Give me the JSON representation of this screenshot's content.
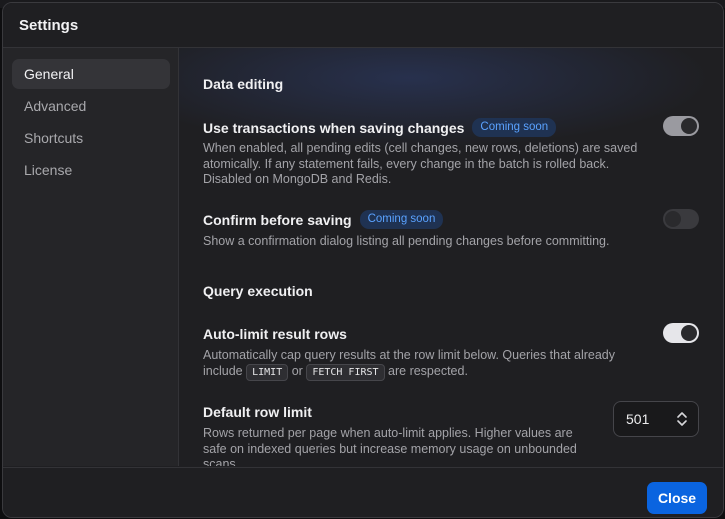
{
  "window": {
    "title": "Settings"
  },
  "sidebar": {
    "items": [
      {
        "label": "General",
        "active": true
      },
      {
        "label": "Advanced",
        "active": false
      },
      {
        "label": "Shortcuts",
        "active": false
      },
      {
        "label": "License",
        "active": false
      }
    ]
  },
  "data_editing": {
    "heading": "Data editing",
    "transactions": {
      "label": "Use transactions when saving changes",
      "badge": "Coming soon",
      "description": "When enabled, all pending edits (cell changes, new rows, deletions) are saved atomically. If any statement fails, every change in the batch is rolled back. Disabled on MongoDB and Redis.",
      "enabled": true
    },
    "confirm": {
      "label": "Confirm before saving",
      "badge": "Coming soon",
      "description": "Show a confirmation dialog listing all pending changes before committing.",
      "enabled": false
    }
  },
  "query_execution": {
    "heading": "Query execution",
    "auto_limit": {
      "label": "Auto-limit result rows",
      "description_before": "Automatically cap query results at the row limit below. Queries that already include",
      "code1": "LIMIT",
      "or": "or",
      "code2": "FETCH FIRST",
      "description_after": "are respected.",
      "enabled": true
    },
    "row_limit": {
      "label": "Default row limit",
      "description": "Rows returned per page when auto-limit applies. Higher values are safe on indexed queries but increase memory usage on unbounded scans.",
      "value": "501"
    }
  },
  "footer": {
    "close_label": "Close"
  },
  "colors": {
    "accent": "#0a64e0",
    "badge_text": "#5aa2ff",
    "badge_bg": "#1f3252",
    "toggle_on": "#e6e6ea",
    "toggle_off": "#3a3a3e"
  },
  "icons": {
    "stepper": "chevron-up-down-icon"
  }
}
